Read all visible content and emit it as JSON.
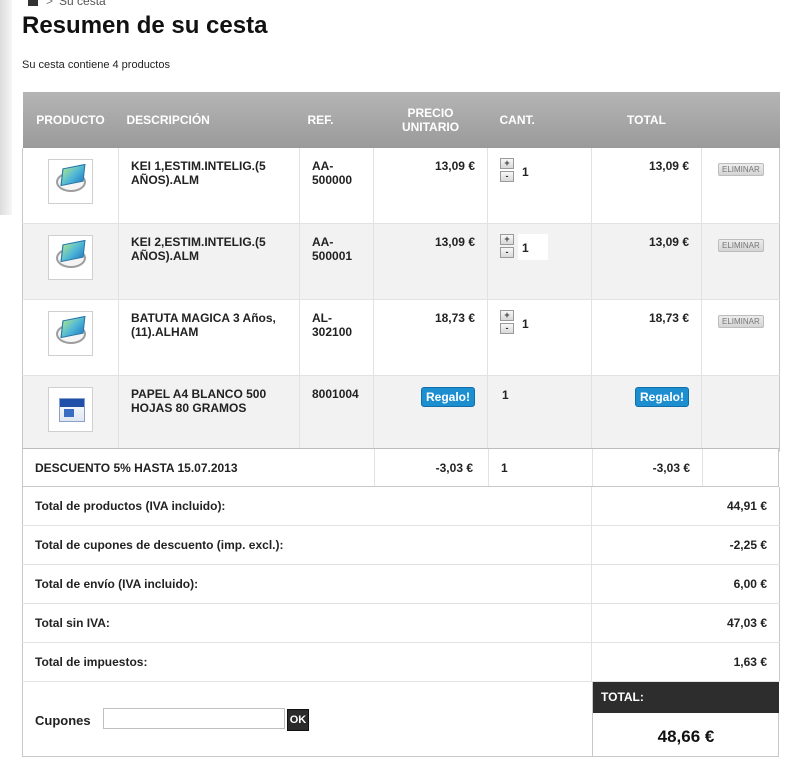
{
  "breadcrumb": {
    "separator": ">",
    "current": "Su cesta"
  },
  "page_title": "Resumen de su cesta",
  "summary": "Su cesta contiene 4 productos",
  "columns": {
    "producto": "PRODUCTO",
    "descripcion": "DESCRIPCIÓN",
    "ref": "REF.",
    "precio": "PRECIO UNITARIO",
    "cant": "CANT.",
    "total": "TOTAL"
  },
  "items": [
    {
      "description": "KEI 1,ESTIM.INTELIG.(5 AÑOS).ALM",
      "ref": "AA-500000",
      "price": "13,09 €",
      "qty": "1",
      "total": "13,09 €",
      "delete": "ELIMINAR",
      "plus": "+",
      "minus": "-",
      "thumb_icon": "book-speech-bubble-icon"
    },
    {
      "description": "KEI 2,ESTIM.INTELIG.(5 AÑOS).ALM",
      "ref": "AA-500001",
      "price": "13,09 €",
      "qty": "1",
      "total": "13,09 €",
      "delete": "ELIMINAR",
      "plus": "+",
      "minus": "-",
      "thumb_icon": "book-speech-bubble-icon"
    },
    {
      "description": "BATUTA MAGICA 3 Años, (11).ALHAM",
      "ref": "AL-302100",
      "price": "18,73 €",
      "qty": "1",
      "total": "18,73 €",
      "delete": "ELIMINAR",
      "plus": "+",
      "minus": "-",
      "thumb_icon": "book-speech-bubble-icon"
    },
    {
      "description": "PAPEL A4 BLANCO 500 HOJAS 80 GRAMOS",
      "ref": "8001004",
      "price": "Regalo!",
      "qty": "1",
      "total": "Regalo!",
      "thumb_icon": "paper-box-icon"
    }
  ],
  "discount": {
    "label": "DESCUENTO 5% HASTA 15.07.2013",
    "price": "-3,03 €",
    "qty": "1",
    "total": "-3,03 €"
  },
  "totals": [
    {
      "label": "Total de productos (IVA incluido):",
      "value": "44,91 €"
    },
    {
      "label": "Total de cupones de descuento (imp. excl.):",
      "value": "-2,25 €"
    },
    {
      "label": "Total de envío (IVA incluido):",
      "value": "6,00 €"
    },
    {
      "label": "Total sin IVA:",
      "value": "47,03 €"
    },
    {
      "label": "Total de impuestos:",
      "value": "1,63 €"
    }
  ],
  "coupon": {
    "label": "Cupones",
    "placeholder": "",
    "button": "OK"
  },
  "grand_total": {
    "label": "TOTAL:",
    "value": "48,66 €"
  },
  "colors": {
    "header_bg": "#a8a8a8",
    "gift_badge": "#1d8fd1",
    "grand_header_bg": "#2d2d2d"
  }
}
